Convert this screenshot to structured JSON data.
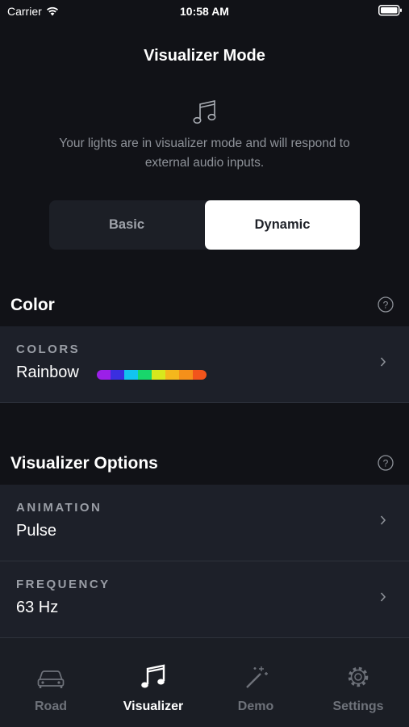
{
  "status_bar": {
    "carrier": "Carrier",
    "time": "10:58 AM"
  },
  "header": {
    "title": "Visualizer Mode",
    "icon": "music-note-icon",
    "description": "Your lights are in visualizer mode and will respond to external audio inputs."
  },
  "mode_toggle": {
    "options": [
      "Basic",
      "Dynamic"
    ],
    "selected": "Dynamic"
  },
  "color_section": {
    "title": "Color",
    "row": {
      "label": "COLORS",
      "value": "Rainbow",
      "swatches": [
        "#9b1fe8",
        "#3a2fe0",
        "#12c4f0",
        "#18d66b",
        "#d8e81d",
        "#f5b71c",
        "#f5901a",
        "#f2541b"
      ]
    }
  },
  "options_section": {
    "title": "Visualizer Options",
    "rows": [
      {
        "label": "ANIMATION",
        "value": "Pulse"
      },
      {
        "label": "FREQUENCY",
        "value": "63 Hz"
      }
    ]
  },
  "tab_bar": {
    "tabs": [
      {
        "label": "Road",
        "icon": "car-icon"
      },
      {
        "label": "Visualizer",
        "icon": "music-note-icon"
      },
      {
        "label": "Demo",
        "icon": "magic-wand-icon"
      },
      {
        "label": "Settings",
        "icon": "gear-icon"
      }
    ],
    "active": "Visualizer"
  },
  "colors": {
    "background": "#111217",
    "row_background": "#1d2029",
    "tab_bar": "#1b1e25",
    "muted_text": "#8e9299"
  }
}
